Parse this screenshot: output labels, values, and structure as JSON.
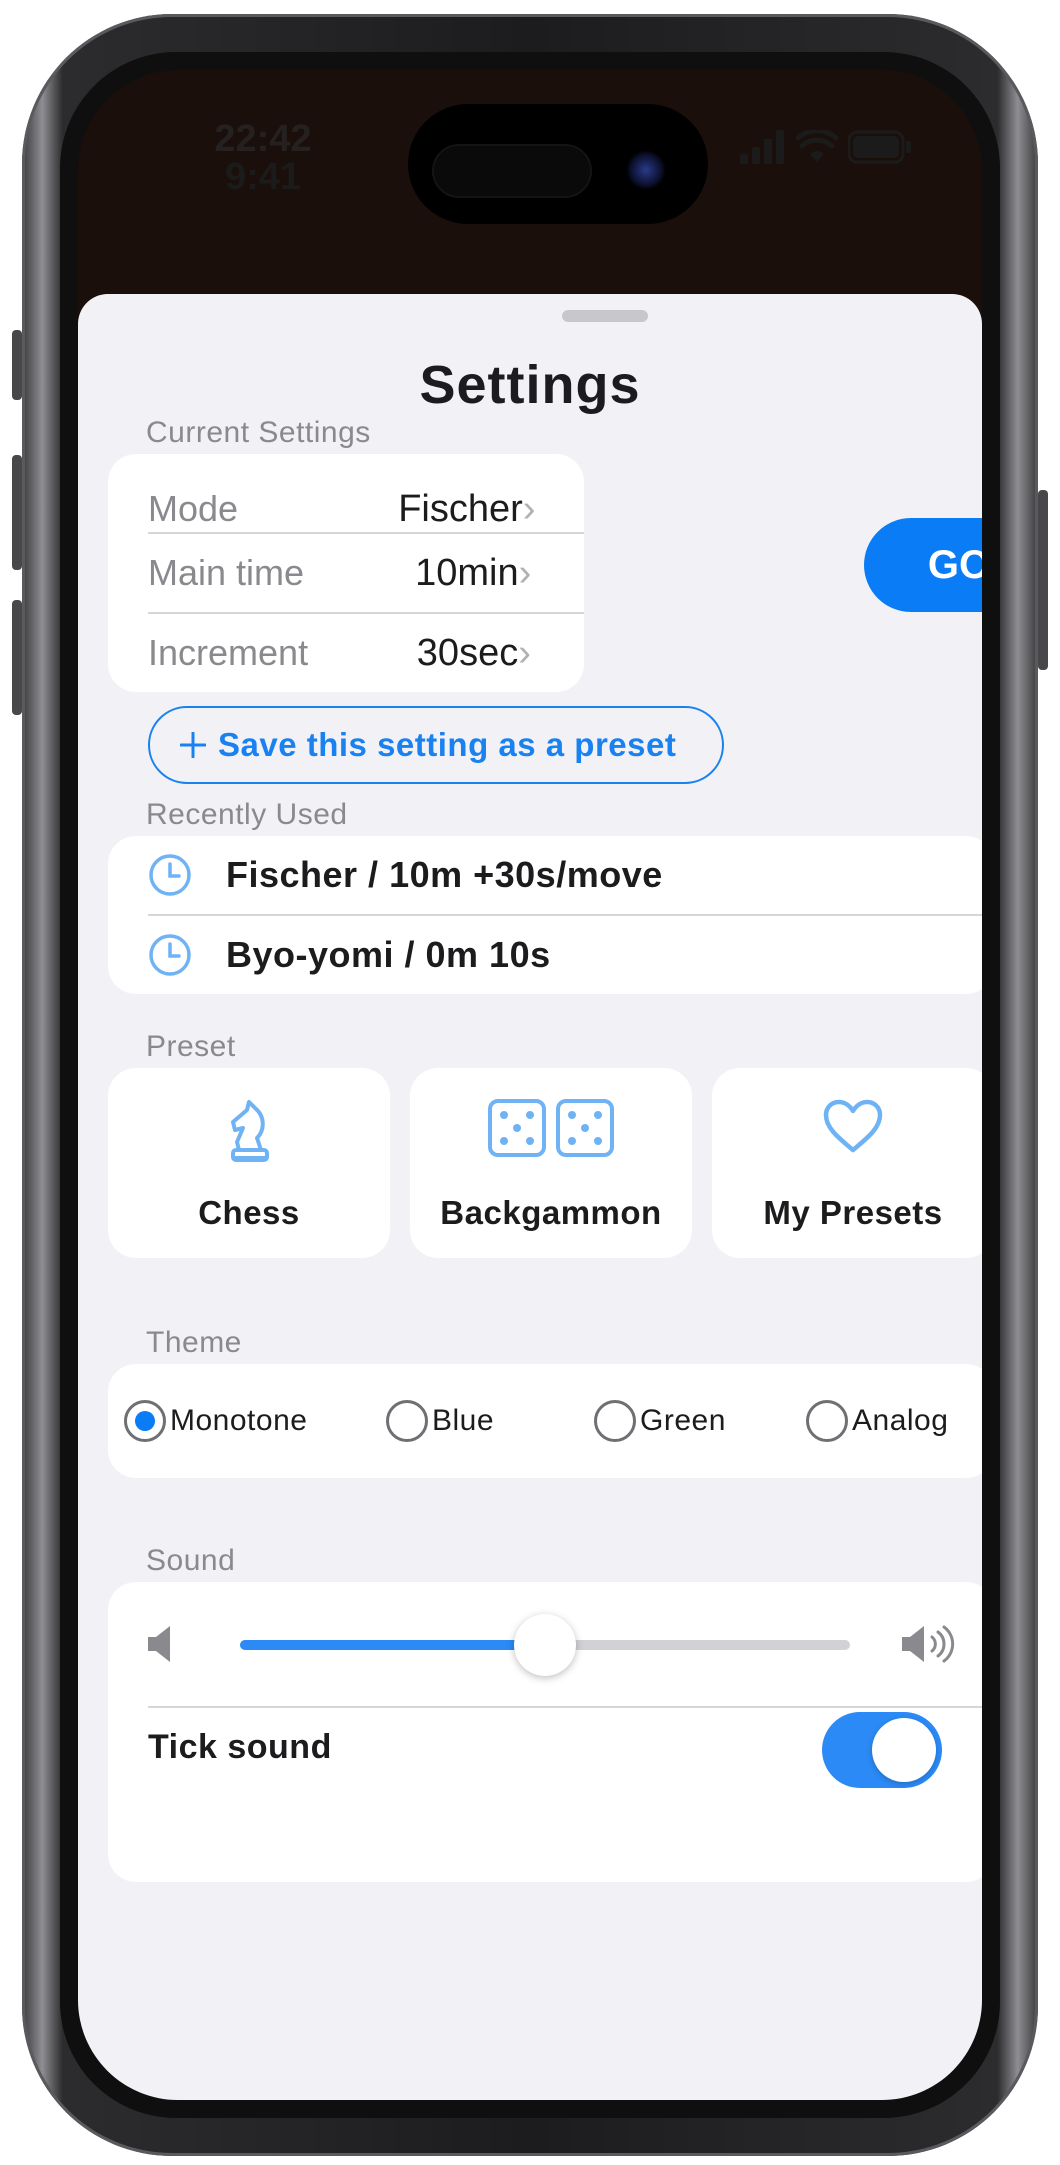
{
  "status_bar": {
    "time_ghost": "22:42",
    "time": "9:41"
  },
  "sheet": {
    "title": "Settings"
  },
  "current_settings": {
    "label": "Current Settings",
    "rows": [
      {
        "label": "Mode",
        "value": "Fischer"
      },
      {
        "label": "Main time",
        "value": "10min"
      },
      {
        "label": "Increment",
        "value": "30sec"
      }
    ],
    "chevron": "›",
    "go_label": "GO",
    "save_preset_label": "Save this setting as a preset",
    "save_preset_icon": "+"
  },
  "recently_used": {
    "label": "Recently Used",
    "items": [
      {
        "icon": "clock-icon",
        "text": "Fischer / 10m +30s/move"
      },
      {
        "icon": "clock-icon",
        "text": "Byo-yomi / 0m 10s"
      }
    ]
  },
  "preset": {
    "label": "Preset",
    "items": [
      {
        "icon": "chess-knight-icon",
        "name": "Chess"
      },
      {
        "icon": "dice-icon",
        "name": "Backgammon"
      },
      {
        "icon": "heart-icon",
        "name": "My Presets"
      }
    ]
  },
  "theme": {
    "label": "Theme",
    "options": [
      "Monotone",
      "Blue",
      "Green",
      "Analog"
    ],
    "selected": "Monotone"
  },
  "sound": {
    "label": "Sound",
    "volume_fraction": 0.5,
    "tick_sound_label": "Tick sound",
    "tick_sound_on": true
  },
  "colors": {
    "accent": "#0a7cf5",
    "icon_blue": "#6fb3f5",
    "sheet_bg": "#f2f2f6"
  }
}
